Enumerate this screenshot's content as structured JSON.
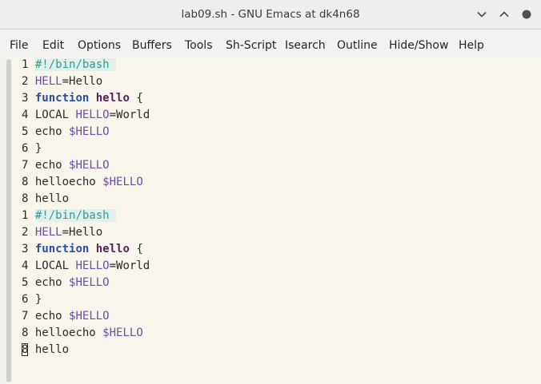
{
  "window": {
    "title": "lab09.sh - GNU Emacs at dk4n68"
  },
  "menubar": {
    "items": [
      "File",
      "Edit",
      "Options",
      "Buffers",
      "Tools",
      "Sh-Script",
      "Isearch",
      "Outline",
      "Hide/Show",
      "Help"
    ]
  },
  "editor": {
    "lines": [
      {
        "num": "1",
        "segments": [
          {
            "t": "#!/bin/bash",
            "c": "shebang"
          }
        ]
      },
      {
        "num": "2",
        "segments": [
          {
            "t": "HELL",
            "c": "var"
          },
          {
            "t": "=Hello",
            "c": ""
          }
        ]
      },
      {
        "num": "3",
        "segments": [
          {
            "t": "function",
            "c": "kw"
          },
          {
            "t": " ",
            "c": ""
          },
          {
            "t": "hello",
            "c": "fn"
          },
          {
            "t": " {",
            "c": ""
          }
        ]
      },
      {
        "num": "4",
        "segments": [
          {
            "t": "LOCAL ",
            "c": ""
          },
          {
            "t": "HELLO",
            "c": "var"
          },
          {
            "t": "=World",
            "c": ""
          }
        ]
      },
      {
        "num": "5",
        "segments": [
          {
            "t": "echo ",
            "c": ""
          },
          {
            "t": "$HELLO",
            "c": "var"
          }
        ]
      },
      {
        "num": "6",
        "segments": [
          {
            "t": "}",
            "c": ""
          }
        ]
      },
      {
        "num": "7",
        "segments": [
          {
            "t": "echo ",
            "c": ""
          },
          {
            "t": "$HELLO",
            "c": "var"
          }
        ]
      },
      {
        "num": "8",
        "segments": [
          {
            "t": "helloecho ",
            "c": ""
          },
          {
            "t": "$HELLO",
            "c": "var"
          }
        ]
      },
      {
        "num": "8",
        "segments": [
          {
            "t": "hello",
            "c": ""
          }
        ]
      },
      {
        "num": "1",
        "segments": [
          {
            "t": "#!/bin/bash",
            "c": "shebang"
          }
        ]
      },
      {
        "num": "2",
        "segments": [
          {
            "t": "HELL",
            "c": "var"
          },
          {
            "t": "=Hello",
            "c": ""
          }
        ]
      },
      {
        "num": "3",
        "segments": [
          {
            "t": "function",
            "c": "kw"
          },
          {
            "t": " ",
            "c": ""
          },
          {
            "t": "hello",
            "c": "fn"
          },
          {
            "t": " {",
            "c": ""
          }
        ]
      },
      {
        "num": "4",
        "segments": [
          {
            "t": "LOCAL ",
            "c": ""
          },
          {
            "t": "HELLO",
            "c": "var"
          },
          {
            "t": "=World",
            "c": ""
          }
        ]
      },
      {
        "num": "5",
        "segments": [
          {
            "t": "echo ",
            "c": ""
          },
          {
            "t": "$HELLO",
            "c": "var"
          }
        ]
      },
      {
        "num": "6",
        "segments": [
          {
            "t": "}",
            "c": ""
          }
        ]
      },
      {
        "num": "7",
        "segments": [
          {
            "t": "echo ",
            "c": ""
          },
          {
            "t": "$HELLO",
            "c": "var"
          }
        ]
      },
      {
        "num": "8",
        "segments": [
          {
            "t": "helloecho ",
            "c": ""
          },
          {
            "t": "$HELLO",
            "c": "var"
          }
        ]
      },
      {
        "num": "8",
        "cursor": true,
        "segments": [
          {
            "t": "hello",
            "c": ""
          }
        ]
      }
    ]
  },
  "icons": {
    "minimize": "chevron-down-icon",
    "maximize": "chevron-up-icon",
    "close": "close-circle-icon"
  },
  "colors": {
    "background": "#f7f5ec",
    "shebang": "#2a9d9a",
    "variable": "#6a4fa0",
    "keyword": "#2a4ca8",
    "function_name": "#5a1f5a"
  }
}
